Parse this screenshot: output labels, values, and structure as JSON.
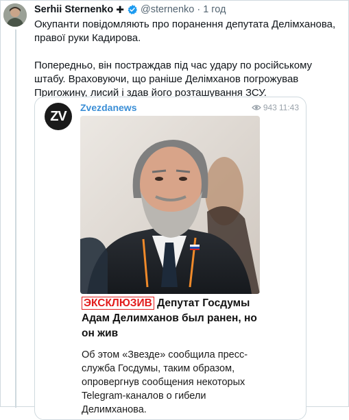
{
  "author": {
    "name": "Serhii Sternenko",
    "badge": "✚",
    "handle": "@sternenko",
    "dot": "·",
    "time": "1 год",
    "verified_icon": "verified-badge-icon"
  },
  "tweet": {
    "paragraph1": "Окупанти повідомляють про поранення депутата Делімханова, правої руки Кадирова.",
    "paragraph2": "Попередньо, він постраждав під час удару по російському штабу. Враховуючи, що раніше Делімханов погрожував Пригожину, лисий і здав його розташування ЗСУ."
  },
  "embed": {
    "channel_logo": "ZV",
    "channel_name": "Zvezdanews",
    "views": "943",
    "post_time": "11:43",
    "tag": "ЭКСКЛЮЗИВ",
    "title": "Депутат Госдумы Адам Делимханов был ранен, но он жив",
    "body": "Об этом «Звезде» сообщила пресс-служба Госдумы, таким образом, опровергнув сообщения некоторых Telegram-каналов о гибели Делимханова."
  },
  "colors": {
    "link_blue": "#3a8ed6",
    "verified_blue": "#1d9bf0",
    "accent_red": "#e21b1b",
    "border": "#cfd9de",
    "muted": "#536471"
  }
}
